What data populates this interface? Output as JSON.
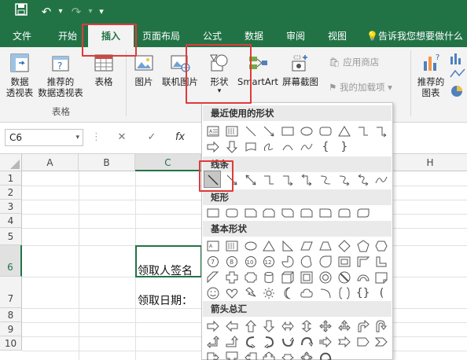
{
  "quick_access": {
    "save_icon": "save-icon",
    "undo_icon": "undo-icon",
    "redo_icon": "redo-icon",
    "customize_icon": "chevron-down-icon"
  },
  "tabs": [
    {
      "label": "文件"
    },
    {
      "label": "开始"
    },
    {
      "label": "插入",
      "active": true
    },
    {
      "label": "页面布局"
    },
    {
      "label": "公式"
    },
    {
      "label": "数据"
    },
    {
      "label": "审阅"
    },
    {
      "label": "视图"
    }
  ],
  "tell_me": {
    "label": "告诉我您想要做什么",
    "icon": "lightbulb-icon"
  },
  "ribbon": {
    "pivot_table": "数据\n透视表",
    "recommended_pivot": "推荐的\n数据透视表",
    "table": "表格",
    "group_tables": "表格",
    "picture": "图片",
    "online_picture": "联机图片",
    "shapes": "形状",
    "smartart": "SmartArt",
    "screenshot": "屏幕截图",
    "app_store": "应用商店",
    "my_addins": "我的加载项",
    "recommended_charts": "推荐的\n图表"
  },
  "formula_bar": {
    "name_box": "C6",
    "cancel": "✕",
    "enter": "✓",
    "fx": "fx"
  },
  "columns": [
    "A",
    "B",
    "C",
    "",
    "H"
  ],
  "rows": [
    "1",
    "2",
    "3",
    "4",
    "5",
    "6",
    "7",
    "8",
    "9",
    "10"
  ],
  "cells": {
    "c6": "领取人签名",
    "c7": "领取日期："
  },
  "shape_menu": {
    "recent": "最近使用的形状",
    "lines": "线条",
    "rectangles": "矩形",
    "basic": "基本形状",
    "arrows": "箭头总汇"
  },
  "colors": {
    "accent": "#217346",
    "highlight": "#e03a3a"
  }
}
